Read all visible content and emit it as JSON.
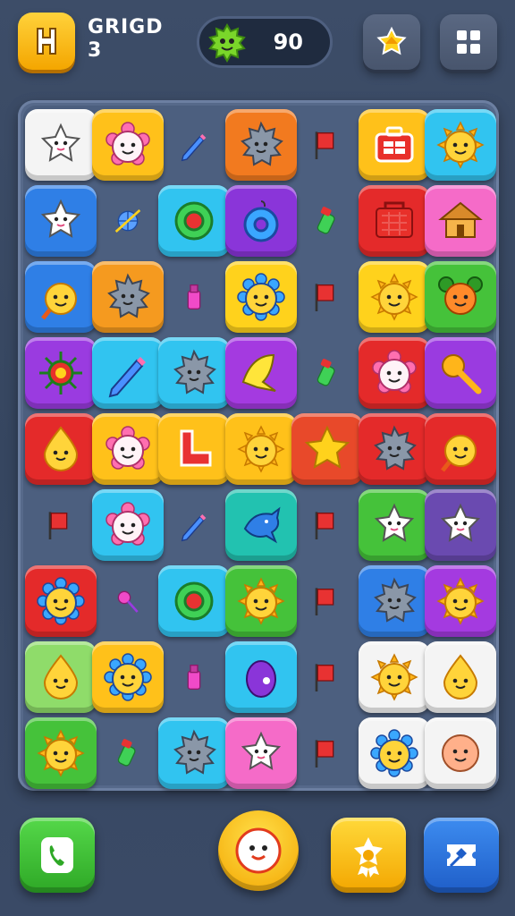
{
  "header": {
    "title_line1": "GRIGD",
    "title_line2": "3",
    "score": "90",
    "score_icon": "green-monster-icon",
    "logo_icon": "logo-icon",
    "right_buttons": [
      {
        "name": "star-button",
        "icon": "star-badge-icon"
      },
      {
        "name": "grid-menu-button",
        "icon": "grid-icon"
      }
    ]
  },
  "board": {
    "rows": 9,
    "cols": 7,
    "tiles": [
      {
        "color": "#f4f4f4",
        "icon": "star-face"
      },
      {
        "color": "#ffc11a",
        "icon": "flower-face"
      },
      {
        "color": "none",
        "icon": "pencil"
      },
      {
        "color": "#f27a1f",
        "icon": "spiky-face"
      },
      {
        "color": "none",
        "icon": "flag"
      },
      {
        "color": "#ffc11a",
        "icon": "briefcase"
      },
      {
        "color": "#31c4f0",
        "icon": "sun-face"
      },
      {
        "color": "#2f7fe6",
        "icon": "star-face"
      },
      {
        "color": "none",
        "icon": "globe"
      },
      {
        "color": "#31c4f0",
        "icon": "gear-ring"
      },
      {
        "color": "#8a35d9",
        "icon": "ring"
      },
      {
        "color": "none",
        "icon": "marker"
      },
      {
        "color": "#e42a2a",
        "icon": "basket"
      },
      {
        "color": "#f56bc8",
        "icon": "house"
      },
      {
        "color": "#2f7fe6",
        "icon": "lolly-face"
      },
      {
        "color": "#f59a1f",
        "icon": "spiky-face"
      },
      {
        "color": "none",
        "icon": "bottle"
      },
      {
        "color": "#ffd21c",
        "icon": "gear-face"
      },
      {
        "color": "none",
        "icon": "flag"
      },
      {
        "color": "#ffd21c",
        "icon": "sun-face"
      },
      {
        "color": "#45c23a",
        "icon": "bear-face"
      },
      {
        "color": "#9a3be0",
        "icon": "sun-burst"
      },
      {
        "color": "#31c4f0",
        "icon": "pencil"
      },
      {
        "color": "#31c4f0",
        "icon": "spiky-face"
      },
      {
        "color": "#a43ae0",
        "icon": "leaf"
      },
      {
        "color": "none",
        "icon": "marker"
      },
      {
        "color": "#e42a2a",
        "icon": "flower-face"
      },
      {
        "color": "#9a3be0",
        "icon": "rattle"
      },
      {
        "color": "#e42a2a",
        "icon": "drop-face"
      },
      {
        "color": "#ffc11a",
        "icon": "flower-face"
      },
      {
        "color": "#ffc11a",
        "icon": "boot"
      },
      {
        "color": "#ffc11a",
        "icon": "sun-face"
      },
      {
        "color": "#e8492a",
        "icon": "star"
      },
      {
        "color": "#e42a2a",
        "icon": "spiky-face"
      },
      {
        "color": "#e42a2a",
        "icon": "lolly-face"
      },
      {
        "color": "none",
        "icon": "flag"
      },
      {
        "color": "#31c4f0",
        "icon": "flower-face"
      },
      {
        "color": "none",
        "icon": "pencil"
      },
      {
        "color": "#22c2b0",
        "icon": "dolphin"
      },
      {
        "color": "none",
        "icon": "flag"
      },
      {
        "color": "#45c23a",
        "icon": "star-face"
      },
      {
        "color": "#6a4ab0",
        "icon": "star-face"
      },
      {
        "color": "#e42a2a",
        "icon": "gear-face"
      },
      {
        "color": "none",
        "icon": "lolly"
      },
      {
        "color": "#31c4f0",
        "icon": "gear-ring"
      },
      {
        "color": "#45c23a",
        "icon": "sun-face"
      },
      {
        "color": "none",
        "icon": "flag"
      },
      {
        "color": "#2f7fe6",
        "icon": "spiky-face"
      },
      {
        "color": "#a43ae0",
        "icon": "sun-face"
      },
      {
        "color": "#8fdc6a",
        "icon": "drop-face"
      },
      {
        "color": "#ffc11a",
        "icon": "gear-face"
      },
      {
        "color": "none",
        "icon": "bottle"
      },
      {
        "color": "#31c4f0",
        "icon": "egg"
      },
      {
        "color": "none",
        "icon": "flag"
      },
      {
        "color": "#f4f4f4",
        "icon": "sun-face"
      },
      {
        "color": "#f4f4f4",
        "icon": "drop-face"
      },
      {
        "color": "#45c23a",
        "icon": "sun-face"
      },
      {
        "color": "none",
        "icon": "marker"
      },
      {
        "color": "#31c4f0",
        "icon": "spiky-face"
      },
      {
        "color": "#f56bc8",
        "icon": "star-face"
      },
      {
        "color": "none",
        "icon": "flag"
      },
      {
        "color": "#f4f4f4",
        "icon": "gear-face"
      },
      {
        "color": "#f4f4f4",
        "icon": "round-face"
      }
    ]
  },
  "footer": {
    "buttons": [
      {
        "name": "phone-button",
        "icon": "phone-icon",
        "color": "#3cc43a"
      },
      {
        "name": "play-button",
        "icon": "face-icon",
        "color": "#ffc11a"
      },
      {
        "name": "badge-button",
        "icon": "star-badge-icon",
        "color": "#ffc11a"
      },
      {
        "name": "shop-button",
        "icon": "ticket-icon",
        "color": "#2f7fe6"
      }
    ]
  }
}
